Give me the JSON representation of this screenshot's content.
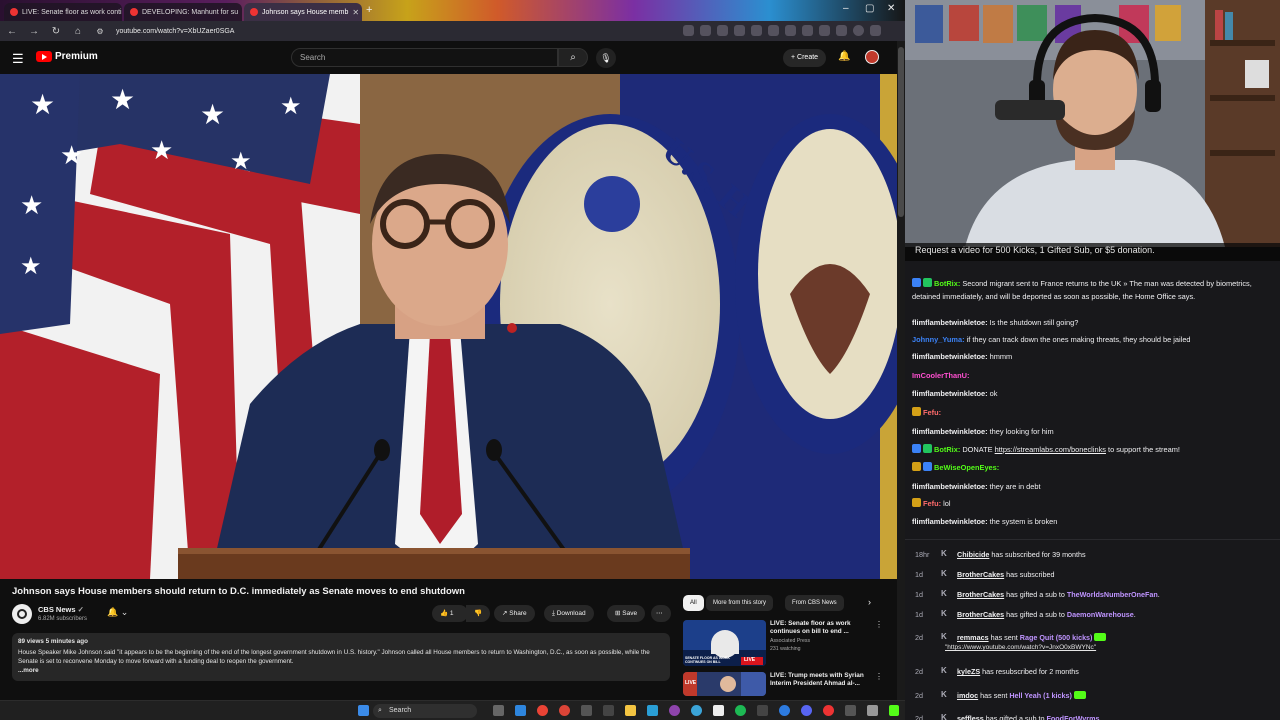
{
  "browser": {
    "tabs": [
      {
        "title": "LIVE: Senate floor as work conti"
      },
      {
        "title": "DEVELOPING: Manhunt for su"
      },
      {
        "title": "Johnson says House memb"
      }
    ],
    "url": "youtube.com/watch?v=XbUZaer0SGA"
  },
  "youtube": {
    "logo_text": "Premium",
    "search_placeholder": "Search",
    "create_label": "Create",
    "video_title": "Johnson says House members should return to D.C. immediately as Senate moves to end shutdown",
    "channel_name": "CBS News",
    "channel_subs": "6.82M subscribers",
    "like_count": "1",
    "share_label": "Share",
    "download_label": "Download",
    "save_label": "Save",
    "desc_meta": "89 views  5 minutes ago",
    "description": "House Speaker Mike Johnson said \"it appears to be the beginning of the end of the longest government shutdown in U.S. history.\" Johnson called all House members to return to Washington, D.C., as soon as possible, while the Senate is set to reconvene Monday to move forward with a funding deal to reopen the government.",
    "more_label": "...more",
    "chips": [
      "All",
      "More from this story",
      "From CBS News"
    ],
    "recommendations": [
      {
        "title": "LIVE: Senate floor as work continues on bill to end ...",
        "channel": "Associated Press",
        "meta": "231 watching",
        "thumb_text": "SENATE FLOOR AS WORK CONTINUES ON BILL",
        "badge": "LIVE"
      },
      {
        "title": "LIVE: Trump meets with Syrian Interim President Ahmad al-...",
        "channel": "",
        "meta": "",
        "thumb_text": "LIVE",
        "badge": ""
      }
    ]
  },
  "taskbar": {
    "search_label": "Search"
  },
  "stream": {
    "request_banner": "Request a video for 500 Kicks, 1 Gifted Sub, or $5 donation.",
    "chat": [
      {
        "user": "BotRix:",
        "text": " Second migrant sent to France returns to the UK » The man was detected by biometrics, detained immediately, and will be deported as soon as possible, the Home Office says.",
        "color": "#53fc18",
        "badges": [
          "#3b82f6",
          "#22c55e"
        ]
      },
      {
        "user": "flimflambetwinkletoe:",
        "text": " Is the shutdown still going?",
        "color": "#efeff1",
        "badges": []
      },
      {
        "user": "Johnny_Yuma:",
        "text": " if they can track down the ones making threats, they should be jailed",
        "color": "#3b82f6",
        "badges": []
      },
      {
        "user": "flimflambetwinkletoe:",
        "text": " hmmm",
        "color": "#efeff1",
        "badges": []
      },
      {
        "user": "ImCoolerThanU:",
        "text": " ",
        "color": "#ff4fd0",
        "badges": []
      },
      {
        "user": "flimflambetwinkletoe:",
        "text": " ok",
        "color": "#efeff1",
        "badges": []
      },
      {
        "user": "Fefu:",
        "text": " ",
        "color": "#ff6b6b",
        "badges": [
          "#d4a017"
        ]
      },
      {
        "user": "flimflambetwinkletoe:",
        "text": " they looking for him",
        "color": "#efeff1",
        "badges": []
      },
      {
        "user": "BotRix:",
        "text": " DONATE ",
        "link": "https://streamlabs.com/boneclinks",
        "after": " to support the stream!",
        "color": "#53fc18",
        "badges": [
          "#3b82f6",
          "#22c55e"
        ]
      },
      {
        "user": "BeWiseOpenEyes:",
        "text": " ",
        "color": "#53fc18",
        "badges": [
          "#d4a017",
          "#3b82f6"
        ]
      },
      {
        "user": "flimflambetwinkletoe:",
        "text": " they are in debt",
        "color": "#efeff1",
        "badges": []
      },
      {
        "user": "Fefu:",
        "text": " lol",
        "color": "#ff6b6b",
        "badges": [
          "#d4a017"
        ]
      },
      {
        "user": "flimflambetwinkletoe:",
        "text": " the system is broken",
        "color": "#efeff1",
        "badges": []
      }
    ],
    "events": [
      {
        "time": "18hr",
        "name": "Chibicide",
        "text": " has subscribed for 39 months"
      },
      {
        "time": "1d",
        "name": "BrotherCakes",
        "text": " has subscribed"
      },
      {
        "time": "1d",
        "name": "BrotherCakes",
        "text": " has gifted a sub to ",
        "bold": "TheWorldsNumberOneFan",
        "end": "."
      },
      {
        "time": "1d",
        "name": "BrotherCakes",
        "text": " has gifted a sub to ",
        "bold": "DaemonWarehouse",
        "end": "."
      },
      {
        "time": "2d",
        "name": "remmacs",
        "text": " has sent ",
        "bold": "Rage Quit (500 kicks)",
        "end": "",
        "sub": "\"https://www.youtube.com/watch?v=JnxO0xBWYNc\""
      },
      {
        "time": "2d",
        "name": "kyleZS",
        "text": " has resubscribed for 2 months"
      },
      {
        "time": "2d",
        "name": "imdoc",
        "text": " has sent ",
        "bold": "Hell Yeah (1 kicks)",
        "end": ""
      },
      {
        "time": "2d",
        "name": "seffless",
        "text": " has gifted a sub to ",
        "bold": "FoodForWyrms",
        "end": "."
      }
    ]
  }
}
